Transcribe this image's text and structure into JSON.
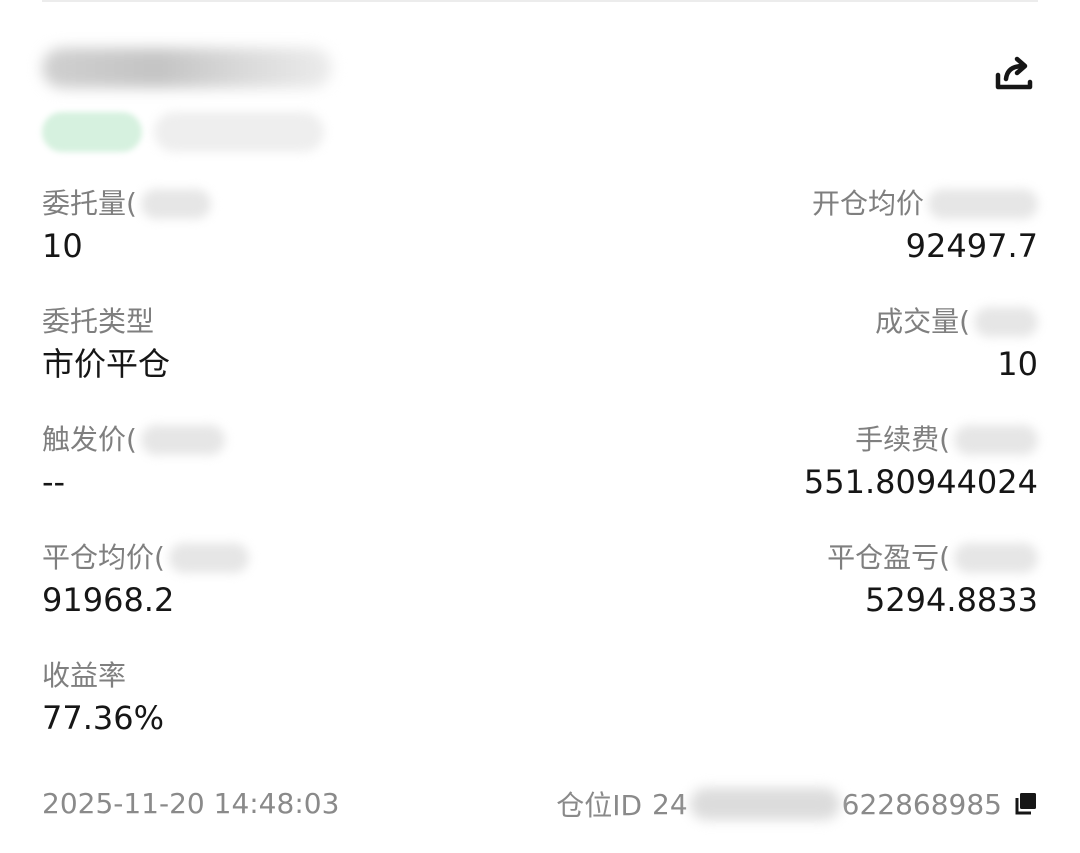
{
  "order": {
    "fields": {
      "order_qty": {
        "label": "委托量(",
        "value": "10"
      },
      "open_avg_price": {
        "label": "开仓均价",
        "value": "92497.7"
      },
      "order_type": {
        "label": "委托类型",
        "value": "市价平仓"
      },
      "filled_qty": {
        "label": "成交量(",
        "value": "10"
      },
      "trigger_price": {
        "label": "触发价(",
        "value": "--"
      },
      "fee": {
        "label": "手续费(",
        "value": "551.80944024"
      },
      "close_avg_price": {
        "label": "平仓均价(",
        "value": "91968.2"
      },
      "close_pnl": {
        "label": "平仓盈亏(",
        "value": "5294.8833"
      },
      "return_rate": {
        "label": "收益率",
        "value": "77.36%"
      }
    },
    "timestamp": "2025-11-20 14:48:03",
    "position_id_label": "仓位ID",
    "position_id_prefix": "24",
    "position_id_suffix": "622868985"
  },
  "icons": {
    "share": "share-icon",
    "copy": "copy-icon"
  },
  "colors": {
    "text_primary": "#161616",
    "text_secondary": "#7f7f7f",
    "tag_green": "#d6f1df"
  }
}
